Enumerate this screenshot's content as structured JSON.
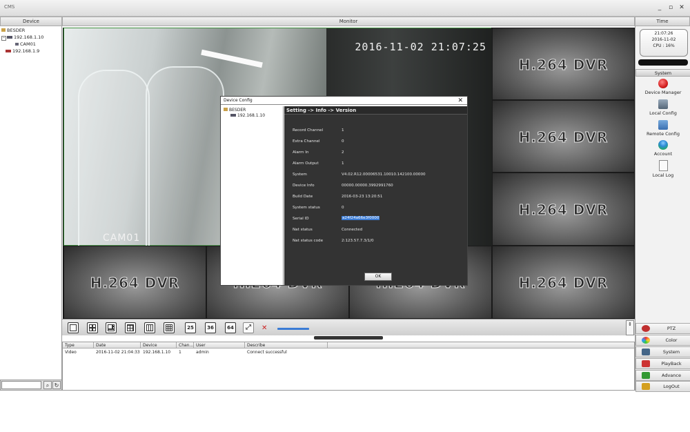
{
  "app": {
    "title": "CMS"
  },
  "window_controls": {
    "minimize": "_",
    "maximize": "▫",
    "close": "✕"
  },
  "headers": {
    "device": "Device",
    "monitor": "Monitor",
    "time": "Time"
  },
  "device_tree": [
    {
      "label": "BESDER"
    },
    {
      "label": "192.168.1.10"
    },
    {
      "label": "CAM01"
    },
    {
      "label": "192.168.1.9"
    }
  ],
  "video": {
    "osd_time": "2016-11-02 21:07:25",
    "camera_name": "CAM01",
    "placeholder_text": "H.264 DVR"
  },
  "clock": {
    "time": "21:07:26",
    "date": "2016-11-02",
    "cpu": "CPU : 16%"
  },
  "system_panel": {
    "header": "System",
    "items": [
      {
        "label": "Device Manager",
        "icon": "record-icon",
        "color": "#d42020"
      },
      {
        "label": "Local Config",
        "icon": "local-config-icon",
        "color": "#5577aa"
      },
      {
        "label": "Remote Config",
        "icon": "remote-config-icon",
        "color": "#3a6fb0"
      },
      {
        "label": "Account",
        "icon": "account-icon",
        "color": "#2f8ad8"
      },
      {
        "label": "Local Log",
        "icon": "document-icon",
        "color": "#eeeeee"
      }
    ]
  },
  "bottom_menu": [
    {
      "label": "PTZ",
      "icon": "ptz-icon",
      "color": "#c03030"
    },
    {
      "label": "Color",
      "icon": "color-icon",
      "color": "#3366cc"
    },
    {
      "label": "System",
      "icon": "system-icon",
      "color": "#446688"
    },
    {
      "label": "PlayBack",
      "icon": "playback-icon",
      "color": "#cc3333"
    },
    {
      "label": "Advance",
      "icon": "advance-icon",
      "color": "#339933"
    },
    {
      "label": "LogOut",
      "icon": "logout-icon",
      "color": "#d4a020"
    }
  ],
  "toolbar": {
    "layout_25": "25",
    "layout_36": "36",
    "layout_64": "64"
  },
  "log": {
    "columns": [
      "Type",
      "Date",
      "Device",
      "Chan...",
      "User",
      "Describe"
    ],
    "rows": [
      {
        "type": "Video",
        "date": "2016-11-02 21:04:33",
        "device": "192.168.1.10",
        "channel": "1",
        "user": "admin",
        "describe": "Connect successful"
      }
    ]
  },
  "dialog": {
    "title": "Device Config",
    "close": "✕",
    "tree": [
      {
        "label": "BESDER"
      },
      {
        "label": "192.168.1.10"
      }
    ],
    "breadcrumb": "Setting -> Info -> Version",
    "fields": [
      {
        "label": "Record Channel",
        "value": "1"
      },
      {
        "label": "Extra Channel",
        "value": "0"
      },
      {
        "label": "Alarm In",
        "value": "2"
      },
      {
        "label": "Alarm Output",
        "value": "1"
      },
      {
        "label": "System",
        "value": "V4.02.R12.00006531.10010.142100.00000"
      },
      {
        "label": "Device Info",
        "value": "00000.00000.3992991760"
      },
      {
        "label": "Build Date",
        "value": "2016-03-23 13:20:51"
      },
      {
        "label": "System status",
        "value": "0"
      },
      {
        "label": "Serial ID",
        "value": "a24f24a66e3f0000"
      },
      {
        "label": "Nat status",
        "value": "Connected"
      },
      {
        "label": "Nat status code",
        "value": "2:123.57.7.3/1/0"
      }
    ],
    "ok": "OK"
  }
}
